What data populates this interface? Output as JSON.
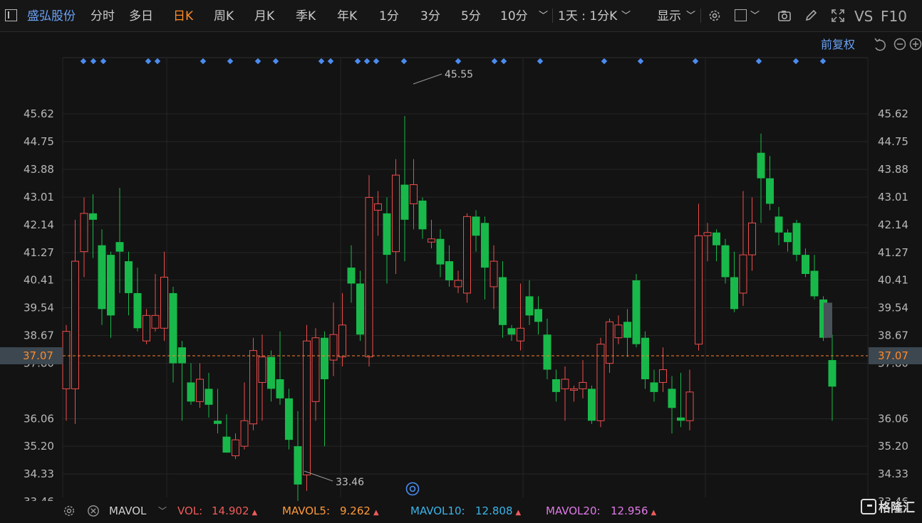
{
  "toolbar": {
    "stock_name": "盛弘股份",
    "period_tabs": [
      "分时",
      "多日",
      "日K",
      "周K",
      "月K",
      "季K",
      "年K",
      "1分",
      "3分",
      "5分",
      "10分"
    ],
    "active_tab": "日K",
    "multi_period": "1天 : 1分K",
    "display": "显示",
    "vs_label": "VS",
    "f10_label": "F10"
  },
  "chart": {
    "adjust_label": "前复权",
    "price_ticks": [
      "45.62",
      "44.75",
      "43.88",
      "43.01",
      "42.14",
      "41.27",
      "40.41",
      "39.54",
      "38.67",
      "37.80",
      "36.06",
      "35.20",
      "34.33",
      "33.46"
    ],
    "current_price": "37.07",
    "high_label": "45.55",
    "low_label": "33.46"
  },
  "chart_data": {
    "type": "candlestick",
    "y_range": [
      32.7,
      46.3
    ],
    "candles": [
      {
        "o": 37.0,
        "c": 38.8,
        "h": 39.0,
        "l": 36.0
      },
      {
        "o": 37.0,
        "c": 41.0,
        "h": 42.3,
        "l": 35.9
      },
      {
        "o": 41.3,
        "c": 42.5,
        "h": 43.0,
        "l": 40.5
      },
      {
        "o": 42.5,
        "c": 42.3,
        "h": 43.1,
        "l": 41.1
      },
      {
        "o": 41.5,
        "c": 39.5,
        "h": 42.0,
        "l": 39.0
      },
      {
        "o": 41.2,
        "c": 39.3,
        "h": 41.3,
        "l": 38.6
      },
      {
        "o": 41.6,
        "c": 41.3,
        "h": 43.3,
        "l": 40.0
      },
      {
        "o": 41.0,
        "c": 40.0,
        "h": 41.3,
        "l": 39.3
      },
      {
        "o": 40.0,
        "c": 38.9,
        "h": 40.8,
        "l": 38.8
      },
      {
        "o": 38.5,
        "c": 39.3,
        "h": 39.5,
        "l": 38.4
      },
      {
        "o": 38.9,
        "c": 39.3,
        "h": 40.6,
        "l": 38.8
      },
      {
        "o": 38.9,
        "c": 40.5,
        "h": 41.3,
        "l": 38.5
      },
      {
        "o": 40.0,
        "c": 37.8,
        "h": 40.2,
        "l": 37.2
      },
      {
        "o": 38.3,
        "c": 37.8,
        "h": 38.5,
        "l": 36.0
      },
      {
        "o": 37.2,
        "c": 36.6,
        "h": 37.8,
        "l": 36.5
      },
      {
        "o": 36.6,
        "c": 37.3,
        "h": 37.8,
        "l": 36.4
      },
      {
        "o": 37.0,
        "c": 36.5,
        "h": 37.5,
        "l": 36.1
      },
      {
        "o": 36.0,
        "c": 35.9,
        "h": 37.0,
        "l": 35.6
      },
      {
        "o": 35.5,
        "c": 35.0,
        "h": 36.2,
        "l": 35.0
      },
      {
        "o": 34.9,
        "c": 35.4,
        "h": 35.6,
        "l": 34.8
      },
      {
        "o": 35.2,
        "c": 36.0,
        "h": 37.2,
        "l": 35.1
      },
      {
        "o": 35.9,
        "c": 38.2,
        "h": 38.6,
        "l": 35.7
      },
      {
        "o": 37.2,
        "c": 38.0,
        "h": 38.7,
        "l": 36.0
      },
      {
        "o": 38.0,
        "c": 37.0,
        "h": 38.2,
        "l": 36.6
      },
      {
        "o": 37.3,
        "c": 36.7,
        "h": 38.8,
        "l": 36.5
      },
      {
        "o": 36.7,
        "c": 35.4,
        "h": 37.0,
        "l": 35.1
      },
      {
        "o": 35.2,
        "c": 34.0,
        "h": 36.3,
        "l": 33.46
      },
      {
        "o": 34.3,
        "c": 38.5,
        "h": 39.0,
        "l": 33.8
      },
      {
        "o": 36.6,
        "c": 38.6,
        "h": 38.9,
        "l": 36.0
      },
      {
        "o": 38.6,
        "c": 37.3,
        "h": 38.8,
        "l": 35.2
      },
      {
        "o": 37.9,
        "c": 38.7,
        "h": 39.7,
        "l": 37.4
      },
      {
        "o": 38.0,
        "c": 39.0,
        "h": 40.0,
        "l": 37.7
      },
      {
        "o": 40.8,
        "c": 40.3,
        "h": 41.5,
        "l": 39.7
      },
      {
        "o": 40.3,
        "c": 38.7,
        "h": 40.7,
        "l": 38.5
      },
      {
        "o": 38.0,
        "c": 43.0,
        "h": 43.7,
        "l": 37.7
      },
      {
        "o": 42.6,
        "c": 42.8,
        "h": 43.2,
        "l": 41.8
      },
      {
        "o": 42.5,
        "c": 41.2,
        "h": 43.0,
        "l": 40.3
      },
      {
        "o": 41.3,
        "c": 43.7,
        "h": 44.2,
        "l": 40.6
      },
      {
        "o": 43.4,
        "c": 42.3,
        "h": 45.55,
        "l": 41.0
      },
      {
        "o": 42.8,
        "c": 43.4,
        "h": 44.2,
        "l": 42.0
      },
      {
        "o": 42.9,
        "c": 42.0,
        "h": 43.0,
        "l": 41.7
      },
      {
        "o": 41.6,
        "c": 41.7,
        "h": 42.3,
        "l": 41.4
      },
      {
        "o": 41.7,
        "c": 40.9,
        "h": 42.0,
        "l": 40.5
      },
      {
        "o": 41.0,
        "c": 40.4,
        "h": 41.5,
        "l": 40.2
      },
      {
        "o": 40.2,
        "c": 40.4,
        "h": 40.7,
        "l": 40.0
      },
      {
        "o": 40.0,
        "c": 42.4,
        "h": 42.5,
        "l": 39.7
      },
      {
        "o": 42.4,
        "c": 41.8,
        "h": 42.6,
        "l": 41.3
      },
      {
        "o": 42.2,
        "c": 40.8,
        "h": 42.4,
        "l": 39.8
      },
      {
        "o": 40.2,
        "c": 41.0,
        "h": 41.5,
        "l": 39.5
      },
      {
        "o": 40.5,
        "c": 39.0,
        "h": 41.0,
        "l": 38.6
      },
      {
        "o": 38.9,
        "c": 38.7,
        "h": 39.0,
        "l": 38.5
      },
      {
        "o": 38.5,
        "c": 38.9,
        "h": 40.3,
        "l": 38.2
      },
      {
        "o": 39.9,
        "c": 39.3,
        "h": 40.4,
        "l": 39.0
      },
      {
        "o": 39.5,
        "c": 39.1,
        "h": 39.9,
        "l": 38.7
      },
      {
        "o": 38.7,
        "c": 37.6,
        "h": 39.2,
        "l": 37.3
      },
      {
        "o": 37.3,
        "c": 36.9,
        "h": 37.6,
        "l": 36.6
      },
      {
        "o": 37.0,
        "c": 37.3,
        "h": 37.7,
        "l": 36.0
      },
      {
        "o": 37.0,
        "c": 37.0,
        "h": 37.1,
        "l": 36.6
      },
      {
        "o": 37.0,
        "c": 37.2,
        "h": 37.9,
        "l": 36.7
      },
      {
        "o": 37.0,
        "c": 36.0,
        "h": 37.1,
        "l": 35.9
      },
      {
        "o": 36.0,
        "c": 38.4,
        "h": 38.6,
        "l": 35.8
      },
      {
        "o": 37.8,
        "c": 39.1,
        "h": 39.2,
        "l": 37.5
      },
      {
        "o": 38.6,
        "c": 39.0,
        "h": 39.3,
        "l": 38.4
      },
      {
        "o": 39.1,
        "c": 38.6,
        "h": 39.5,
        "l": 38.0
      },
      {
        "o": 40.4,
        "c": 38.4,
        "h": 40.6,
        "l": 38.3
      },
      {
        "o": 38.6,
        "c": 37.3,
        "h": 38.8,
        "l": 37.0
      },
      {
        "o": 37.2,
        "c": 36.9,
        "h": 37.6,
        "l": 36.6
      },
      {
        "o": 37.2,
        "c": 37.6,
        "h": 38.3,
        "l": 36.9
      },
      {
        "o": 37.0,
        "c": 36.4,
        "h": 37.4,
        "l": 35.6
      },
      {
        "o": 36.1,
        "c": 36.0,
        "h": 37.5,
        "l": 35.8
      },
      {
        "o": 36.0,
        "c": 36.9,
        "h": 37.6,
        "l": 35.7
      },
      {
        "o": 38.4,
        "c": 41.8,
        "h": 42.8,
        "l": 38.2
      },
      {
        "o": 41.8,
        "c": 41.9,
        "h": 42.2,
        "l": 41.0
      },
      {
        "o": 41.9,
        "c": 41.5,
        "h": 42.0,
        "l": 41.0
      },
      {
        "o": 41.5,
        "c": 40.5,
        "h": 41.7,
        "l": 40.3
      },
      {
        "o": 40.5,
        "c": 39.5,
        "h": 41.3,
        "l": 39.4
      },
      {
        "o": 40.0,
        "c": 41.2,
        "h": 43.2,
        "l": 39.6
      },
      {
        "o": 41.2,
        "c": 42.2,
        "h": 43.0,
        "l": 40.7
      },
      {
        "o": 44.4,
        "c": 43.6,
        "h": 45.0,
        "l": 42.2
      },
      {
        "o": 43.6,
        "c": 42.8,
        "h": 44.3,
        "l": 42.6
      },
      {
        "o": 42.4,
        "c": 41.9,
        "h": 42.7,
        "l": 41.5
      },
      {
        "o": 41.9,
        "c": 41.6,
        "h": 42.0,
        "l": 41.3
      },
      {
        "o": 42.2,
        "c": 41.2,
        "h": 42.3,
        "l": 41.0
      },
      {
        "o": 41.2,
        "c": 40.6,
        "h": 41.4,
        "l": 40.5
      },
      {
        "o": 40.7,
        "c": 39.9,
        "h": 41.2,
        "l": 39.8
      },
      {
        "o": 39.8,
        "c": 38.6,
        "h": 39.9,
        "l": 38.5
      },
      {
        "o": 37.9,
        "c": 37.07,
        "h": 38.7,
        "l": 36.0
      }
    ]
  },
  "volume_bar": {
    "indicator": "MAVOL",
    "vol_label": "VOL:",
    "vol_value": "14.902",
    "mavol5_label": "MAVOL5:",
    "mavol5_value": "9.262",
    "mavol10_label": "MAVOL10:",
    "mavol10_value": "12.808",
    "mavol20_label": "MAVOL20:",
    "mavol20_value": "12.956",
    "arrow": "▲"
  },
  "brand": {
    "logo_text": "格隆汇"
  },
  "colors": {
    "up": "#ef4c4c",
    "down": "#18b94a",
    "accent": "#ff8a2a",
    "link": "#5b9bf0"
  }
}
